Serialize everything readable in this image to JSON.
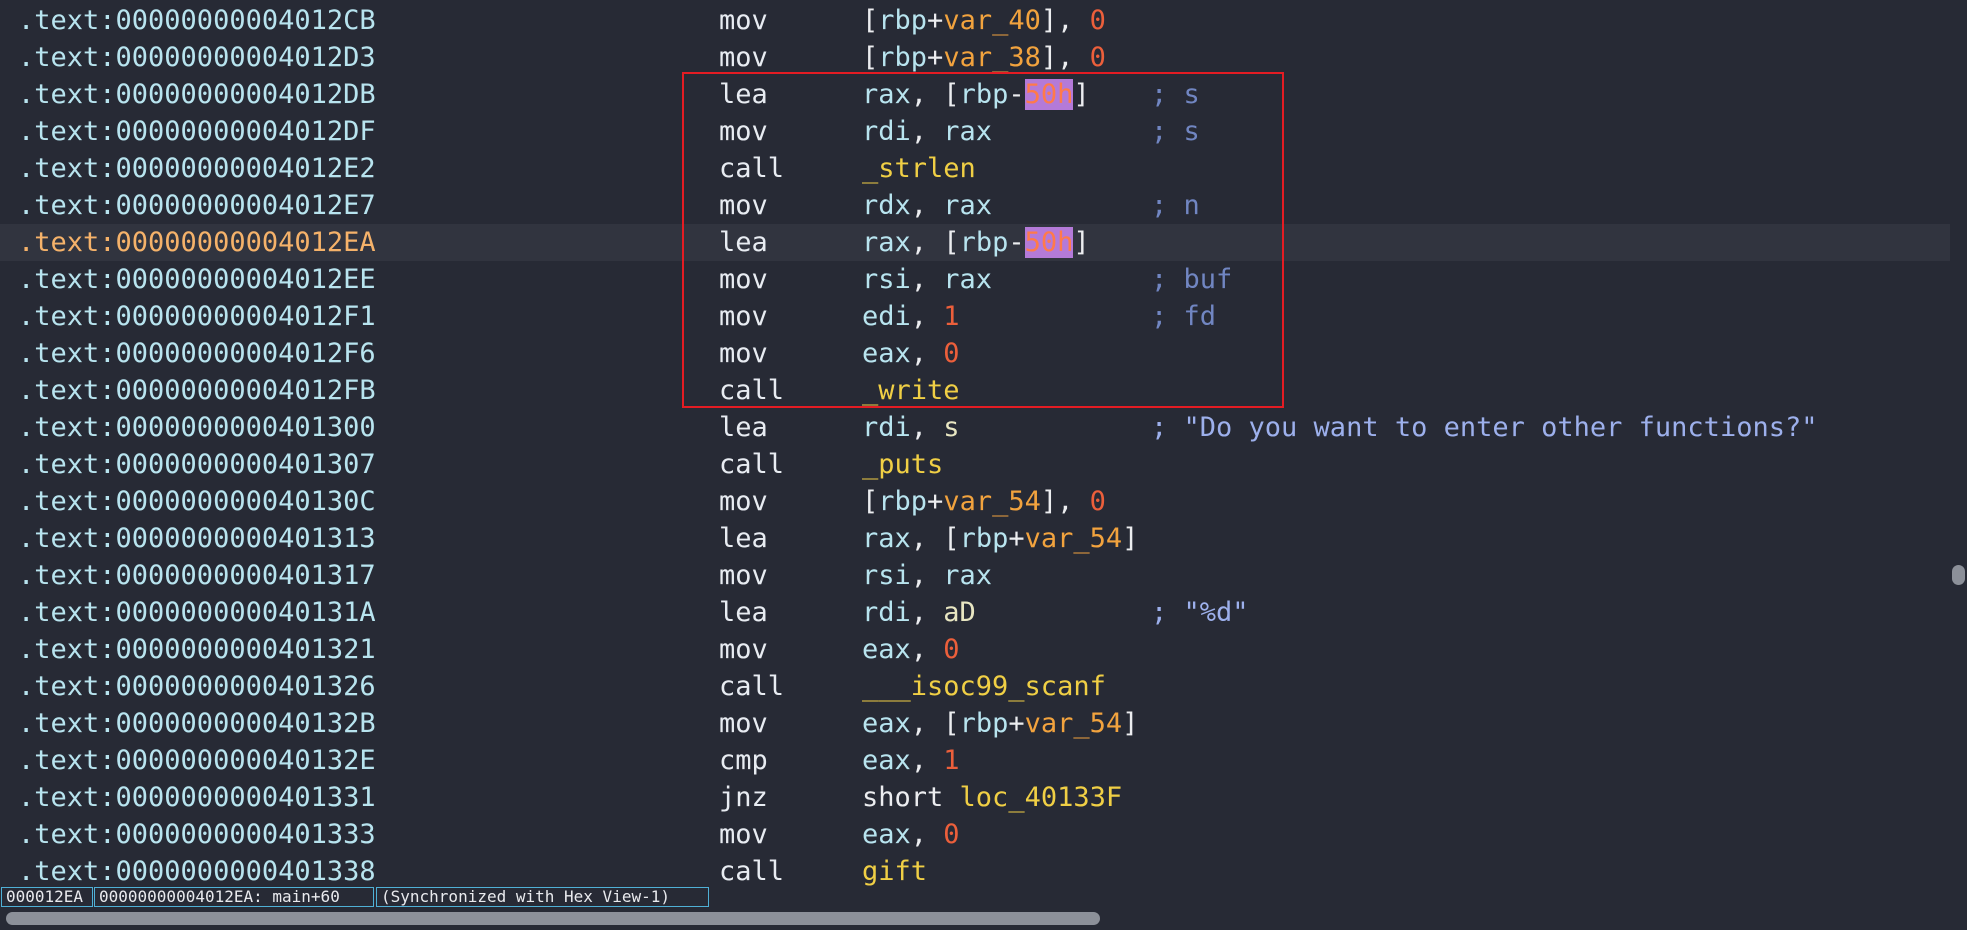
{
  "listing": {
    "lines": [
      {
        "addr": ".text:00000000004012CB",
        "mnemonic": "mov",
        "operands": [
          {
            "t": "[",
            "c": "punct"
          },
          {
            "t": "rbp",
            "c": "reg"
          },
          {
            "t": "+",
            "c": "punct"
          },
          {
            "t": "var_40",
            "c": "var"
          },
          {
            "t": "], ",
            "c": "punct"
          },
          {
            "t": "0",
            "c": "num"
          }
        ],
        "comment": ""
      },
      {
        "addr": ".text:00000000004012D3",
        "mnemonic": "mov",
        "operands": [
          {
            "t": "[",
            "c": "punct"
          },
          {
            "t": "rbp",
            "c": "reg"
          },
          {
            "t": "+",
            "c": "punct"
          },
          {
            "t": "var_38",
            "c": "var"
          },
          {
            "t": "], ",
            "c": "punct"
          },
          {
            "t": "0",
            "c": "num"
          }
        ],
        "comment": ""
      },
      {
        "addr": ".text:00000000004012DB",
        "mnemonic": "lea",
        "operands": [
          {
            "t": "rax",
            "c": "reg"
          },
          {
            "t": ", [",
            "c": "punct"
          },
          {
            "t": "rbp",
            "c": "reg"
          },
          {
            "t": "-",
            "c": "punct"
          },
          {
            "t": "50h",
            "c": "hl"
          },
          {
            "t": "]",
            "c": "punct"
          }
        ],
        "comment": "; s"
      },
      {
        "addr": ".text:00000000004012DF",
        "mnemonic": "mov",
        "operands": [
          {
            "t": "rdi",
            "c": "reg"
          },
          {
            "t": ", ",
            "c": "punct"
          },
          {
            "t": "rax",
            "c": "reg"
          }
        ],
        "comment": "; s"
      },
      {
        "addr": ".text:00000000004012E2",
        "mnemonic": "call",
        "operands": [
          {
            "t": "_strlen",
            "c": "sym"
          }
        ],
        "comment": ""
      },
      {
        "addr": ".text:00000000004012E7",
        "mnemonic": "mov",
        "operands": [
          {
            "t": "rdx",
            "c": "reg"
          },
          {
            "t": ", ",
            "c": "punct"
          },
          {
            "t": "rax",
            "c": "reg"
          }
        ],
        "comment": "; n"
      },
      {
        "addr": ".text:00000000004012EA",
        "mnemonic": "lea",
        "operands": [
          {
            "t": "rax",
            "c": "reg"
          },
          {
            "t": ", [",
            "c": "punct"
          },
          {
            "t": "rbp",
            "c": "reg"
          },
          {
            "t": "-",
            "c": "punct"
          },
          {
            "t": "50h",
            "c": "hl"
          },
          {
            "t": "]",
            "c": "punct"
          }
        ],
        "comment": "",
        "current": true
      },
      {
        "addr": ".text:00000000004012EE",
        "mnemonic": "mov",
        "operands": [
          {
            "t": "rsi",
            "c": "reg"
          },
          {
            "t": ", ",
            "c": "punct"
          },
          {
            "t": "rax",
            "c": "reg"
          }
        ],
        "comment": "; buf"
      },
      {
        "addr": ".text:00000000004012F1",
        "mnemonic": "mov",
        "operands": [
          {
            "t": "edi",
            "c": "reg"
          },
          {
            "t": ", ",
            "c": "punct"
          },
          {
            "t": "1",
            "c": "num"
          }
        ],
        "comment": "; fd"
      },
      {
        "addr": ".text:00000000004012F6",
        "mnemonic": "mov",
        "operands": [
          {
            "t": "eax",
            "c": "reg"
          },
          {
            "t": ", ",
            "c": "punct"
          },
          {
            "t": "0",
            "c": "num"
          }
        ],
        "comment": ""
      },
      {
        "addr": ".text:00000000004012FB",
        "mnemonic": "call",
        "operands": [
          {
            "t": "_write",
            "c": "sym"
          }
        ],
        "comment": ""
      },
      {
        "addr": ".text:0000000000401300",
        "mnemonic": "lea",
        "operands": [
          {
            "t": "rdi",
            "c": "reg"
          },
          {
            "t": ", ",
            "c": "punct"
          },
          {
            "t": "s",
            "c": "data"
          }
        ],
        "comment": "; \"Do you want to enter other functions?\"",
        "comment_str": true
      },
      {
        "addr": ".text:0000000000401307",
        "mnemonic": "call",
        "operands": [
          {
            "t": "_puts",
            "c": "sym"
          }
        ],
        "comment": ""
      },
      {
        "addr": ".text:000000000040130C",
        "mnemonic": "mov",
        "operands": [
          {
            "t": "[",
            "c": "punct"
          },
          {
            "t": "rbp",
            "c": "reg"
          },
          {
            "t": "+",
            "c": "punct"
          },
          {
            "t": "var_54",
            "c": "var"
          },
          {
            "t": "], ",
            "c": "punct"
          },
          {
            "t": "0",
            "c": "num"
          }
        ],
        "comment": ""
      },
      {
        "addr": ".text:0000000000401313",
        "mnemonic": "lea",
        "operands": [
          {
            "t": "rax",
            "c": "reg"
          },
          {
            "t": ", [",
            "c": "punct"
          },
          {
            "t": "rbp",
            "c": "reg"
          },
          {
            "t": "+",
            "c": "punct"
          },
          {
            "t": "var_54",
            "c": "var"
          },
          {
            "t": "]",
            "c": "punct"
          }
        ],
        "comment": ""
      },
      {
        "addr": ".text:0000000000401317",
        "mnemonic": "mov",
        "operands": [
          {
            "t": "rsi",
            "c": "reg"
          },
          {
            "t": ", ",
            "c": "punct"
          },
          {
            "t": "rax",
            "c": "reg"
          }
        ],
        "comment": ""
      },
      {
        "addr": ".text:000000000040131A",
        "mnemonic": "lea",
        "operands": [
          {
            "t": "rdi",
            "c": "reg"
          },
          {
            "t": ", ",
            "c": "punct"
          },
          {
            "t": "aD",
            "c": "data"
          }
        ],
        "comment": "; \"%d\"",
        "comment_str": true
      },
      {
        "addr": ".text:0000000000401321",
        "mnemonic": "mov",
        "operands": [
          {
            "t": "eax",
            "c": "reg"
          },
          {
            "t": ", ",
            "c": "punct"
          },
          {
            "t": "0",
            "c": "num"
          }
        ],
        "comment": ""
      },
      {
        "addr": ".text:0000000000401326",
        "mnemonic": "call",
        "operands": [
          {
            "t": "___isoc99_scanf",
            "c": "sym"
          }
        ],
        "comment": ""
      },
      {
        "addr": ".text:000000000040132B",
        "mnemonic": "mov",
        "operands": [
          {
            "t": "eax",
            "c": "reg"
          },
          {
            "t": ", [",
            "c": "punct"
          },
          {
            "t": "rbp",
            "c": "reg"
          },
          {
            "t": "+",
            "c": "punct"
          },
          {
            "t": "var_54",
            "c": "var"
          },
          {
            "t": "]",
            "c": "punct"
          }
        ],
        "comment": ""
      },
      {
        "addr": ".text:000000000040132E",
        "mnemonic": "cmp",
        "operands": [
          {
            "t": "eax",
            "c": "reg"
          },
          {
            "t": ", ",
            "c": "punct"
          },
          {
            "t": "1",
            "c": "num"
          }
        ],
        "comment": ""
      },
      {
        "addr": ".text:0000000000401331",
        "mnemonic": "jnz",
        "operands": [
          {
            "t": "short ",
            "c": "punct"
          },
          {
            "t": "loc_40133F",
            "c": "sym"
          }
        ],
        "comment": ""
      },
      {
        "addr": ".text:0000000000401333",
        "mnemonic": "mov",
        "operands": [
          {
            "t": "eax",
            "c": "reg"
          },
          {
            "t": ", ",
            "c": "punct"
          },
          {
            "t": "0",
            "c": "num"
          }
        ],
        "comment": ""
      },
      {
        "addr": ".text:0000000000401338",
        "mnemonic": "call",
        "operands": [
          {
            "t": "gift",
            "c": "sym"
          }
        ],
        "comment": ""
      }
    ]
  },
  "status": {
    "offset": "000012EA",
    "location": "00000000004012EA: main+60",
    "sync": "(Synchronized with Hex View-1)"
  },
  "colors": {
    "background": "#272a35",
    "highlight_box": "#e41c23",
    "current_address": "#f5b26a",
    "selection_highlight": "#b47ad8"
  }
}
